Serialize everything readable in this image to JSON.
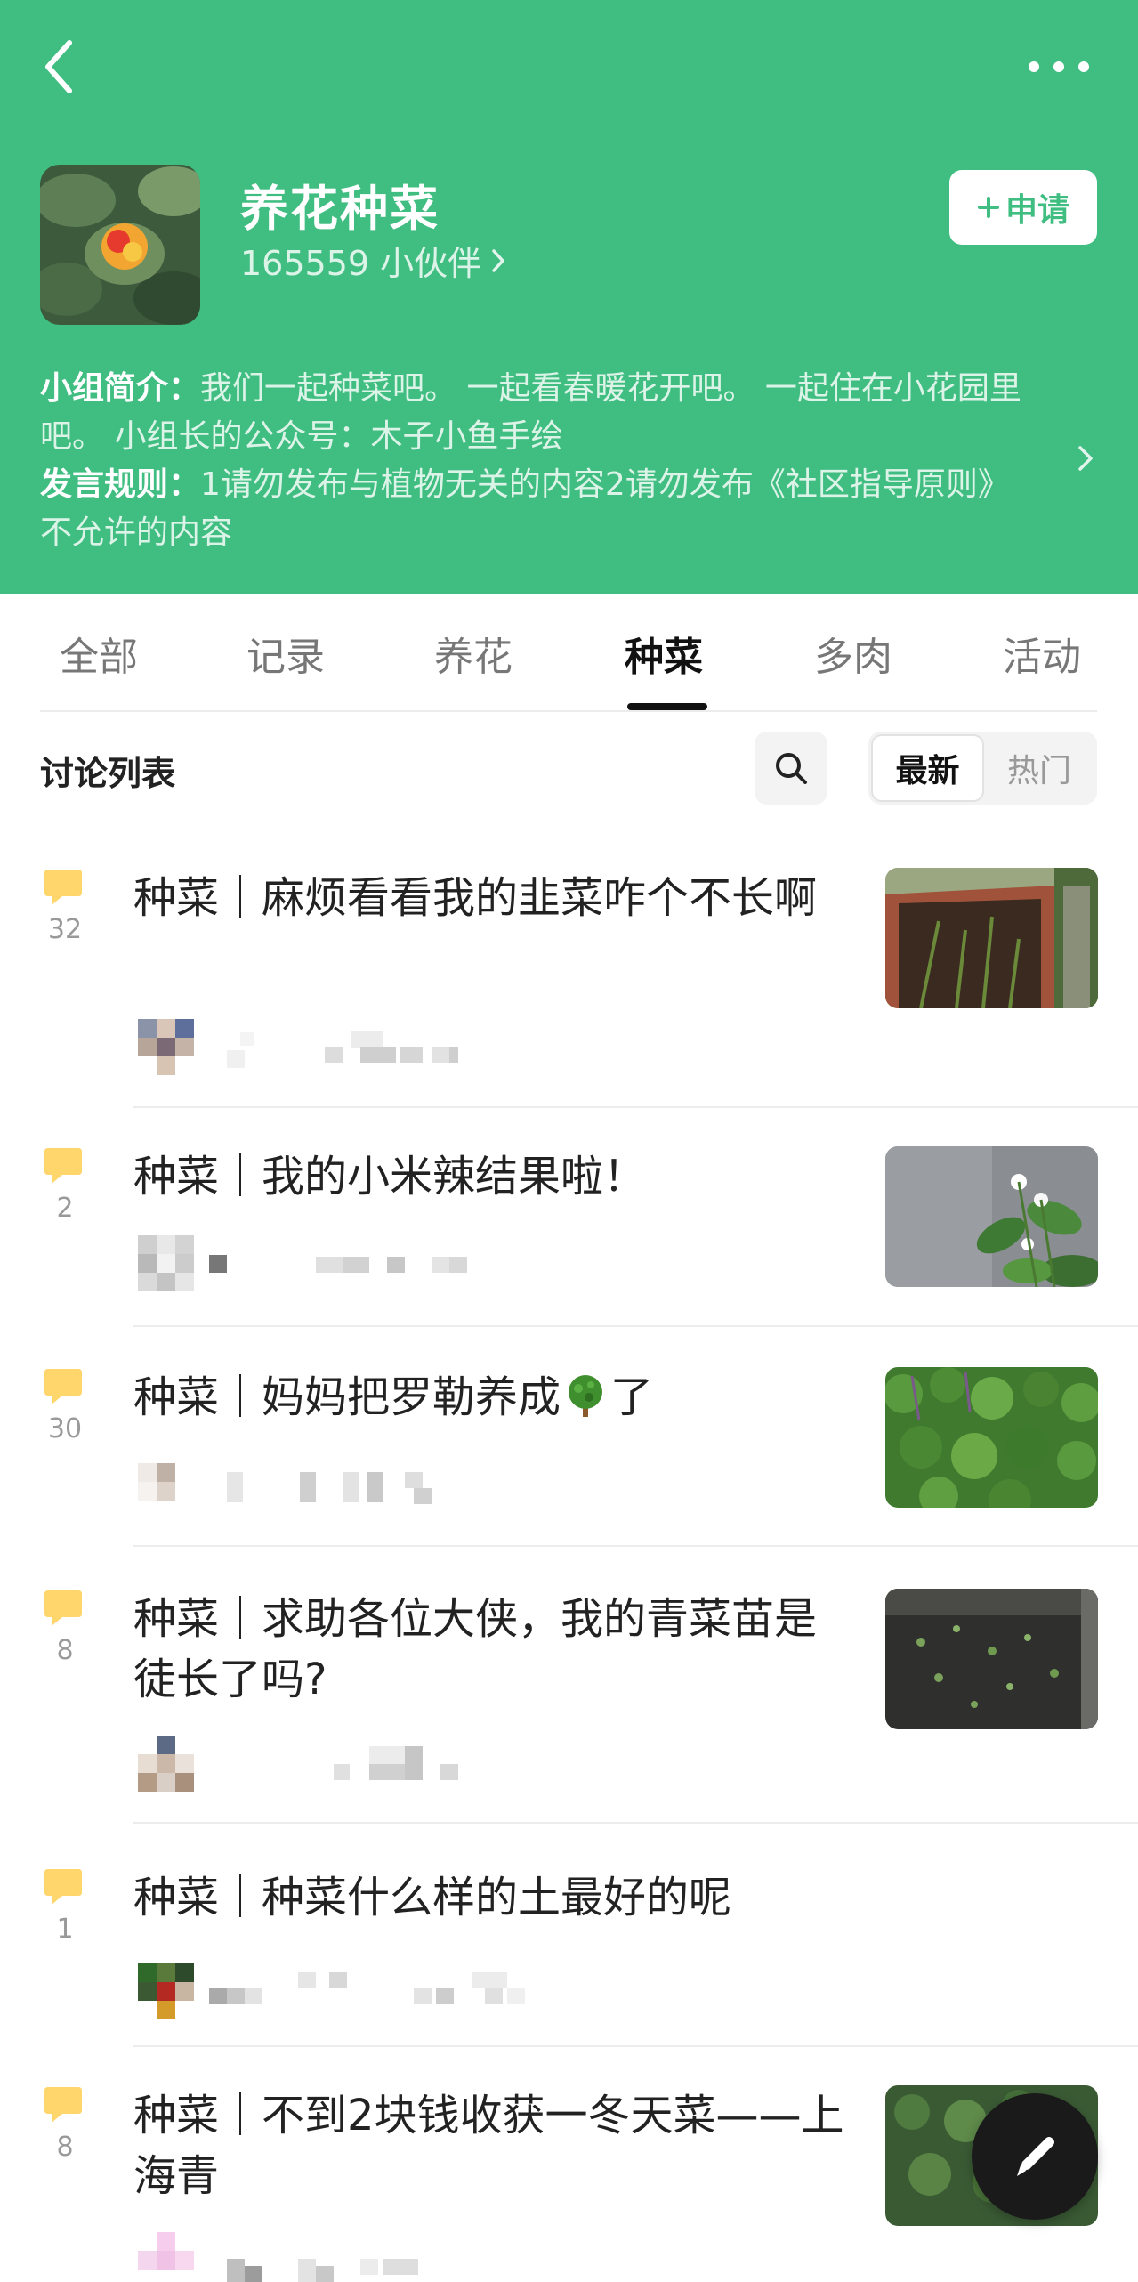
{
  "colors": {
    "brand_green": "#40BE82",
    "bubble_yellow": "#FFD66B",
    "fab": "#1a1a1a"
  },
  "header": {
    "group_name": "养花种菜",
    "member_count": "165559 小伙伴",
    "join_label": "申请",
    "intro_label": "小组简介：",
    "intro_text": "我们一起种菜吧。 一起看春暖花开吧。 一起住在小花园里吧。 小组长的公众号：木子小鱼手绘",
    "rules_label": "发言规则：",
    "rules_text": "1请勿发布与植物无关的内容2请勿发布《社区指导原则》不允许的内容"
  },
  "tabs": [
    {
      "label": "全部"
    },
    {
      "label": "记录"
    },
    {
      "label": "养花"
    },
    {
      "label": "种菜",
      "active": true
    },
    {
      "label": "多肉"
    },
    {
      "label": "活动"
    }
  ],
  "list": {
    "title": "讨论列表",
    "sort_options": [
      "最新",
      "热门"
    ],
    "sort_selected": "最新"
  },
  "posts": [
    {
      "count": "32",
      "title": "种菜｜麻烦看看我的韭菜咋个不长啊",
      "has_thumb": true
    },
    {
      "count": "2",
      "title": "种菜｜我的小米辣结果啦！",
      "has_thumb": true
    },
    {
      "count": "30",
      "title_before": "种菜｜妈妈把罗勒养成",
      "emoji": "tree-icon",
      "title_after": "了",
      "has_thumb": true
    },
    {
      "count": "8",
      "title": "种菜｜求助各位大侠，我的青菜苗是徒长了吗?",
      "has_thumb": true
    },
    {
      "count": "1",
      "title": "种菜｜种菜什么样的土最好的呢",
      "has_thumb": false
    },
    {
      "count": "8",
      "title": "种菜｜不到2块钱收获一冬天菜——上海青",
      "has_thumb": true
    }
  ],
  "icons": {
    "back": "chevron-left-icon",
    "more": "more-dots-icon",
    "search": "search-icon",
    "compose": "pen-icon"
  }
}
